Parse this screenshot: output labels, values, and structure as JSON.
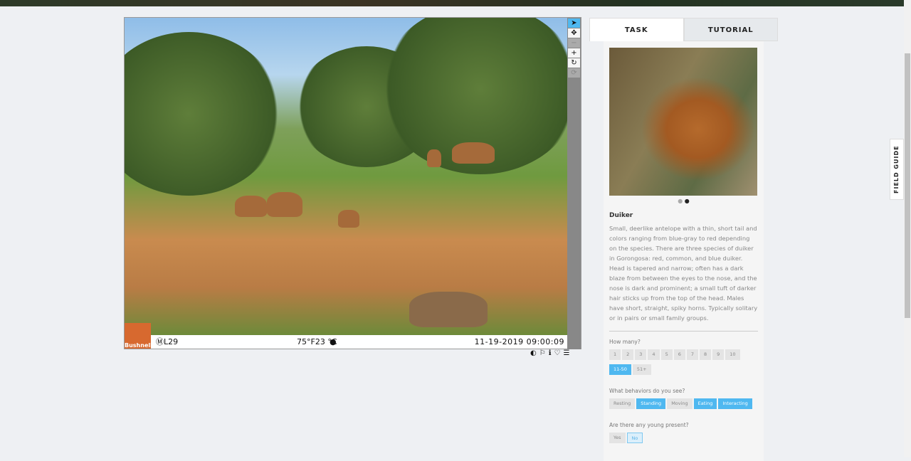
{
  "viewer": {
    "tools": [
      "pointer",
      "move",
      "zoom-out",
      "zoom-in",
      "rotate",
      "reset"
    ],
    "caption": {
      "logo": "Bushnell",
      "camera": "ⓂL29",
      "temperature": "75°F23 °C",
      "moon": "●",
      "datetime": "11-19-2019 09:00:09"
    },
    "bottom_icons": [
      "contrast",
      "flag",
      "info",
      "favorite",
      "collection"
    ]
  },
  "panel": {
    "tabs": [
      "TASK",
      "TUTORIAL"
    ],
    "species": "Duiker",
    "description": "Small, deerlike antelope with a thin, short tail and colors ranging from blue-gray to red depending on the species. There are three species of duiker in Gorongosa: red, common, and blue duiker. Head is tapered and narrow; often has a dark blaze from between the eyes to the nose, and the nose is dark and prominent; a small tuft of darker hair sticks up from the top of the head. Males have short, straight, spiky horns. Typically solitary or in pairs or small family groups.",
    "how_many": {
      "label": "How many?",
      "options": [
        "1",
        "2",
        "3",
        "4",
        "5",
        "6",
        "7",
        "8",
        "9",
        "10",
        "11-50",
        "51+"
      ],
      "selected": "11-50"
    },
    "behaviors": {
      "label": "What behaviors do you see?",
      "options": [
        "Resting",
        "Standing",
        "Moving",
        "Eating",
        "Interacting"
      ],
      "selected": [
        "Standing",
        "Eating",
        "Interacting"
      ]
    },
    "young": {
      "label": "Are there any young present?",
      "options": [
        "Yes",
        "No"
      ],
      "selected": "No"
    }
  },
  "field_guide": "FIELD GUIDE"
}
